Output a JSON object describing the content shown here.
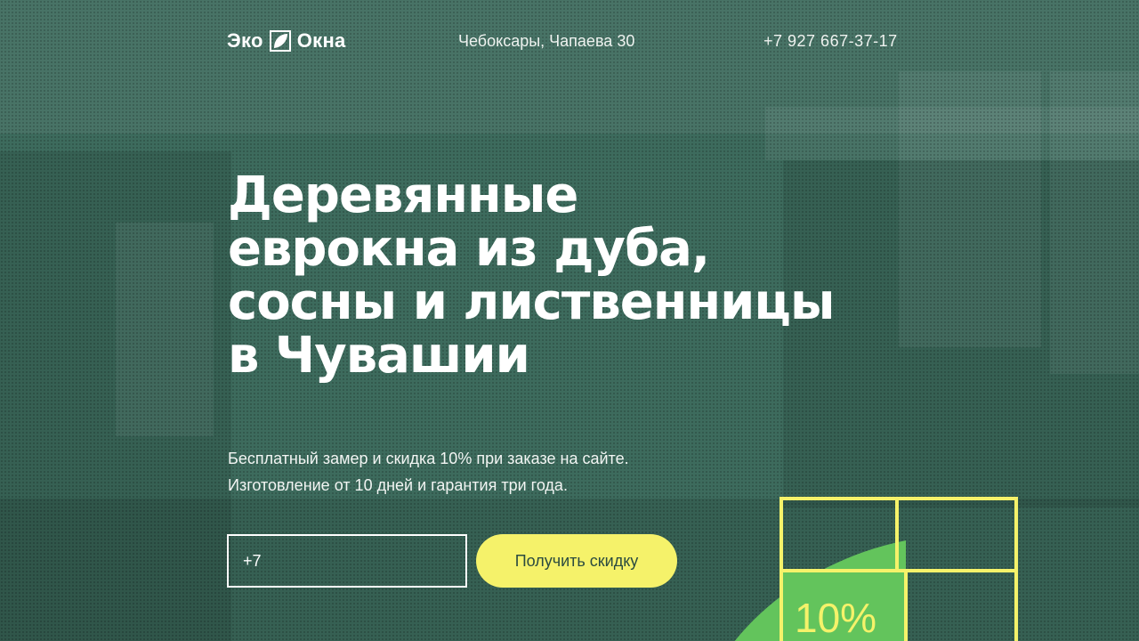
{
  "header": {
    "logo_left": "Эко",
    "logo_right": "Окна",
    "address": "Чебоксары, Чапаева 30",
    "phone": "+7 927 667-37-17"
  },
  "hero": {
    "title_lines": [
      "Деревянные",
      "еврокна из дуба,",
      "сосны и лиственницы",
      "в Чувашии"
    ],
    "subtitle_lines": [
      "Бесплатный замер и скидка 10% при заказе на сайте.",
      "Изготовление от 10 дней и гарантия три года."
    ]
  },
  "form": {
    "phone_value": "+7",
    "button_label": "Получить скидку"
  },
  "promo": {
    "discount": "10%"
  },
  "colors": {
    "background": "#3d6b5d",
    "accent_yellow": "#f5f26a",
    "leaf_green": "#63c45c",
    "text": "#ffffff"
  }
}
